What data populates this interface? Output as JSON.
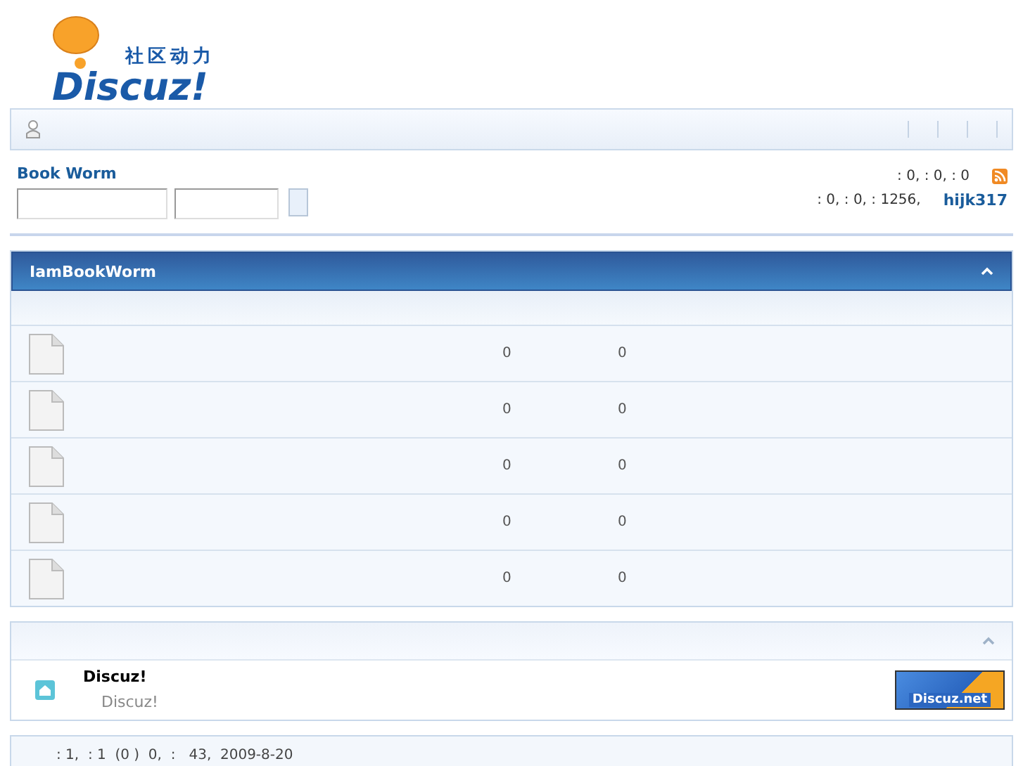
{
  "logo": {
    "tagline": "社区动力",
    "name": "Discuz!"
  },
  "info": {
    "forum_name": "Book Worm",
    "stats_line_1": ": 0,  : 0,  : 0",
    "stats_line_2": ": 0,  : 0,  : 1256,",
    "username": "hijk317"
  },
  "category": {
    "title": "IamBookWorm",
    "expanded": true,
    "forums": [
      {
        "topics": "0",
        "posts": "0"
      },
      {
        "topics": "0",
        "posts": "0"
      },
      {
        "topics": "0",
        "posts": "0"
      },
      {
        "topics": "0",
        "posts": "0"
      },
      {
        "topics": "0",
        "posts": "0"
      }
    ]
  },
  "links": {
    "expanded": true,
    "items": [
      {
        "name": "Discuz!",
        "description": "Discuz!",
        "banner": "Discuz.net"
      }
    ]
  },
  "online": {
    "summary": ": 1,  : 1  (0 )  0,  :   43,  2009-8-20"
  }
}
